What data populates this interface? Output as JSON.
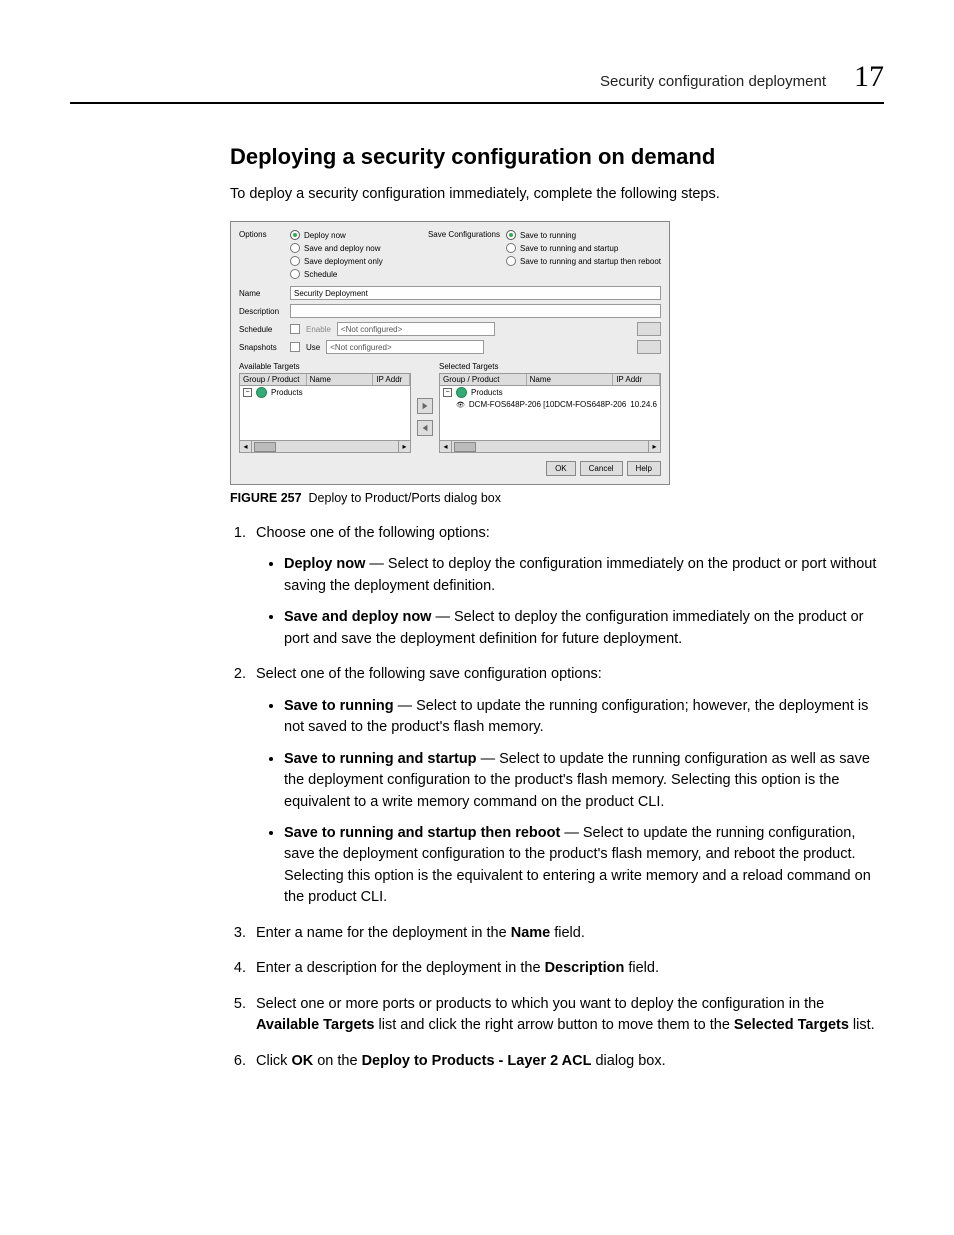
{
  "header": {
    "section_title": "Security configuration deployment",
    "chapter_number": "17"
  },
  "title": "Deploying a security configuration on demand",
  "lead": "To deploy a security configuration immediately, complete the following steps.",
  "dialog": {
    "options_label": "Options",
    "opt_deploy_now": "Deploy now",
    "opt_save_deploy": "Save and deploy now",
    "opt_save_only": "Save deployment only",
    "opt_schedule": "Schedule",
    "save_config_label": "Save Configurations",
    "sc_running": "Save to running",
    "sc_startup": "Save to running and startup",
    "sc_reboot": "Save to running and startup then reboot",
    "name_label": "Name",
    "name_value": "Security Deployment",
    "desc_label": "Description",
    "schedule_label": "Schedule",
    "schedule_enable": "Enable",
    "schedule_value": "<Not configured>",
    "snapshots_label": "Snapshots",
    "snapshots_use": "Use",
    "snapshots_value": "<Not configured>",
    "available_title": "Available Targets",
    "selected_title": "Selected Targets",
    "col_group": "Group / Product",
    "col_name": "Name",
    "col_ip": "IP Addr",
    "products_node": "Products",
    "sel_product_line": "DCM-FOS648P-206 [10DCM-FOS648P-206",
    "sel_product_ip": "10.24.6",
    "btn_ok": "OK",
    "btn_cancel": "Cancel",
    "btn_help": "Help"
  },
  "figure": {
    "label": "FIGURE 257",
    "caption": "Deploy to Product/Ports dialog box"
  },
  "steps": {
    "s1": "Choose one of the following options:",
    "s1_b1_bold": "Deploy now",
    "s1_b1_rest": " — Select to deploy the configuration immediately on the product or port without saving the deployment definition.",
    "s1_b2_bold": "Save and deploy now",
    "s1_b2_rest": " — Select to deploy the configuration immediately on the product or port and save the deployment definition for future deployment.",
    "s2": "Select one of the following save configuration options:",
    "s2_b1_bold": "Save to running",
    "s2_b1_rest": " — Select to update the running configuration; however, the deployment is not saved to the product's flash memory.",
    "s2_b2_bold": "Save to running and startup",
    "s2_b2_rest": " — Select to update the running configuration as well as save the deployment configuration to the product's flash memory. Selecting this option is the equivalent to a write memory command on the product CLI.",
    "s2_b3_bold": "Save to running and startup then reboot",
    "s2_b3_rest": " — Select to update the running configuration, save the deployment configuration to the product's flash memory, and reboot the product. Selecting this option is the equivalent to entering a write memory and a reload command on the product CLI.",
    "s3_pre": "Enter a name for the deployment in the ",
    "s3_bold": "Name",
    "s3_post": " field.",
    "s4_pre": "Enter a description for the deployment in the ",
    "s4_bold": "Description",
    "s4_post": " field.",
    "s5_pre": "Select one or more ports or products to which you want to deploy the configuration in the ",
    "s5_b1": "Available Targets",
    "s5_mid": " list and click the right arrow button to move them to the ",
    "s5_b2": "Selected Targets",
    "s5_post": " list.",
    "s6_pre": "Click ",
    "s6_b1": "OK",
    "s6_mid": " on the ",
    "s6_b2": "Deploy to Products - Layer 2 ACL",
    "s6_post": " dialog box."
  }
}
